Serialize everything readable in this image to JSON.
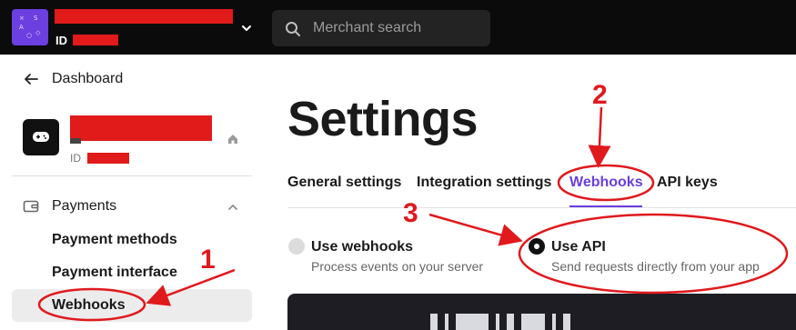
{
  "topbar": {
    "merchant_id_label": "ID",
    "search_placeholder": "Merchant search",
    "logo_glyphs": [
      "×",
      "S",
      "A",
      "○",
      "◇"
    ]
  },
  "sidebar": {
    "back_label": "Dashboard",
    "app_id_label": "ID",
    "section_label": "Payments",
    "items": [
      {
        "label": "Payment methods"
      },
      {
        "label": "Payment interface"
      },
      {
        "label": "Webhooks",
        "active": true
      }
    ]
  },
  "main": {
    "title": "Settings",
    "tabs": [
      {
        "label": "General settings"
      },
      {
        "label": "Integration settings"
      },
      {
        "label": "Webhooks",
        "active": true
      },
      {
        "label": "API keys"
      }
    ],
    "options": [
      {
        "title": "Use webhooks",
        "desc": "Process events on your server",
        "selected": false
      },
      {
        "title": "Use API",
        "desc": "Send requests directly from your app",
        "selected": true
      }
    ]
  },
  "annotations": {
    "numbers": [
      "1",
      "2",
      "3"
    ],
    "color": "#e0191d"
  },
  "colors": {
    "accent": "#6b3fe0",
    "topbar": "#0b0b0b",
    "redaction": "#e11a1a"
  }
}
